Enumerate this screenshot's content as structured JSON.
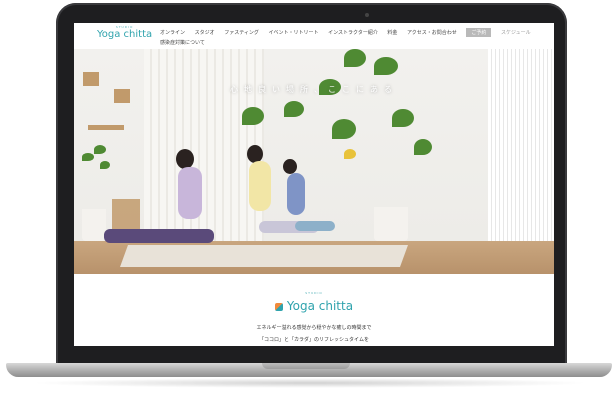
{
  "site": {
    "logo_small": "STUDIO",
    "logo_main": "Yoga chitta",
    "nav": [
      "オンライン",
      "スタジオ",
      "ファスティング",
      "イベント・リトリート",
      "インストラクター紹介",
      "料金",
      "アクセス・お問合わせ"
    ],
    "nav_active": "ご予約",
    "nav_muted": "スケジュール",
    "nav_second_line": "感染症対策について"
  },
  "hero": {
    "copy": "心地良い場所、ここにある"
  },
  "content": {
    "logo_small": "STUDIO",
    "logo_main": "Yoga chitta",
    "tagline_1": "エネルギー溢れる感覚から穏やかな癒しの時間まで",
    "tagline_2": "「ココロ」と「カラダ」のリフレッシュタイムを"
  },
  "colors": {
    "brand_teal": "#2fa3ad",
    "brand_orange": "#f08a3c",
    "laptop_bezel": "#1e1e20"
  }
}
